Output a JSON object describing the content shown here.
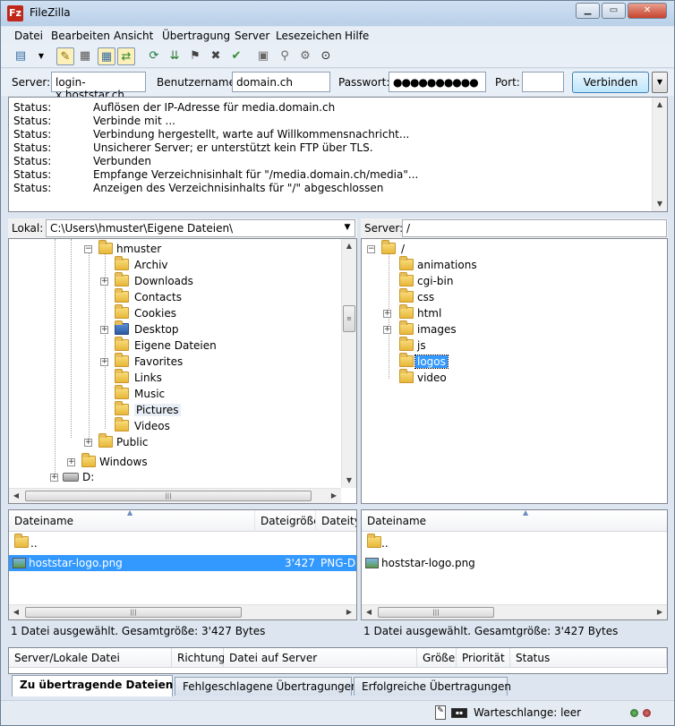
{
  "window": {
    "title": "FileZilla",
    "app_icon": "Fz"
  },
  "menu": [
    "Datei",
    "Bearbeiten",
    "Ansicht",
    "Übertragung",
    "Server",
    "Lesezeichen",
    "Hilfe"
  ],
  "toolbar": {
    "icons": [
      "site-manager-icon",
      "dropdown-arrow-icon",
      "message-log-toggle-icon",
      "local-tree-toggle-icon",
      "remote-tree-toggle-icon",
      "queue-toggle-icon",
      "refresh-icon",
      "process-queue-icon",
      "cancel-icon",
      "disconnect-icon",
      "reconnect-icon",
      "filter-icon",
      "compare-icon",
      "sync-browse-icon",
      "search-icon"
    ]
  },
  "quickconnect": {
    "server_label": "Server:",
    "server_value": "login-x.hoststar.ch",
    "user_label": "Benutzername:",
    "user_value": "domain.ch",
    "pass_label": "Passwort:",
    "pass_value": "●●●●●●●●●●",
    "port_label": "Port:",
    "port_value": "",
    "connect_label": "Verbinden"
  },
  "log": [
    {
      "k": "Status:",
      "v": "Auflösen der IP-Adresse für media.domain.ch"
    },
    {
      "k": "Status:",
      "v": "Verbinde mit ..."
    },
    {
      "k": "Status:",
      "v": "Verbindung hergestellt, warte auf Willkommensnachricht..."
    },
    {
      "k": "Status:",
      "v": "Unsicherer Server; er unterstützt kein FTP über TLS."
    },
    {
      "k": "Status:",
      "v": "Verbunden"
    },
    {
      "k": "Status:",
      "v": "Empfange Verzeichnisinhalt für \"/media.domain.ch/media\"..."
    },
    {
      "k": "Status:",
      "v": "Anzeigen des Verzeichnisinhalts für \"/\" abgeschlossen"
    }
  ],
  "local": {
    "path_label": "Lokal:",
    "path_value": "C:\\Users\\hmuster\\Eigene Dateien\\",
    "tree": {
      "hmuster": "hmuster",
      "items": [
        "Archiv",
        "Downloads",
        "Contacts",
        "Cookies",
        "Desktop",
        "Eigene Dateien",
        "Favorites",
        "Links",
        "Music",
        "Pictures",
        "Videos"
      ],
      "public": "Public",
      "windows": "Windows",
      "drive": "D:"
    },
    "list_headers": {
      "name": "Dateiname",
      "size": "Dateigröße",
      "type": "Dateityp"
    },
    "rows": [
      {
        "name": "..",
        "size": "",
        "type": ""
      },
      {
        "name": "hoststar-logo.png",
        "size": "3'427",
        "type": "PNG-D"
      }
    ],
    "status": "1 Datei ausgewählt. Gesamtgröße: 3'427 Bytes"
  },
  "remote": {
    "path_label": "Server:",
    "path_value": "/",
    "tree": {
      "root": "/",
      "items": [
        "animations",
        "cgi-bin",
        "css",
        "html",
        "images",
        "js",
        "logos",
        "video"
      ]
    },
    "list_headers": {
      "name": "Dateiname"
    },
    "rows": [
      {
        "name": ".."
      },
      {
        "name": "hoststar-logo.png"
      }
    ],
    "status": "1 Datei ausgewählt. Gesamtgröße: 3'427 Bytes"
  },
  "queue": {
    "columns": [
      "Server/Lokale Datei",
      "Richtung",
      "Datei auf Server",
      "Größe",
      "Priorität",
      "Status"
    ]
  },
  "tabs": [
    "Zu übertragende Dateien",
    "Fehlgeschlagene Übertragungen",
    "Erfolgreiche Übertragungen"
  ],
  "statusbar": {
    "queue_label": "Warteschlange: leer"
  },
  "colors": {
    "selection": "#3399ff",
    "folder": "#e8b73a"
  }
}
